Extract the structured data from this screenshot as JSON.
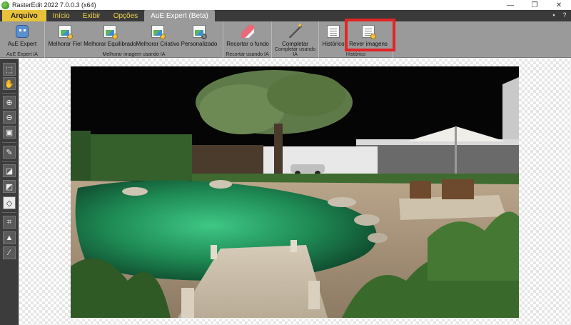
{
  "window": {
    "title": "RasterEdit 2022 7.0.0.3 (x64)",
    "minimize_glyph": "—",
    "restore_glyph": "❐",
    "close_glyph": "✕"
  },
  "menu": {
    "tabs": [
      {
        "label": "Arquivo"
      },
      {
        "label": "Início"
      },
      {
        "label": "Exibir"
      },
      {
        "label": "Opções"
      },
      {
        "label": "AuE Expert (Beta)"
      }
    ],
    "active_tab": "AuE Expert (Beta)",
    "save_glyph": "💾",
    "help_glyph": "?"
  },
  "ribbon": {
    "groups": [
      {
        "label": "AuE Expert IA",
        "buttons": [
          {
            "label": "AuE Expert",
            "icon": "robot-icon"
          }
        ]
      },
      {
        "label": "Melhorar imagem usando IA",
        "buttons": [
          {
            "label": "Melhorar Fiel",
            "icon": "image-sparkle-icon"
          },
          {
            "label": "Melhorar Equilibrado",
            "icon": "image-sparkle-icon"
          },
          {
            "label": "Melhorar Criativo",
            "icon": "image-sparkle-icon"
          },
          {
            "label": "Personalizado",
            "icon": "image-gear-icon"
          }
        ]
      },
      {
        "label": "Recortar usando IA",
        "buttons": [
          {
            "label": "Recortar o fundo",
            "icon": "eraser-icon"
          }
        ]
      },
      {
        "label": "Completar usando IA",
        "buttons": [
          {
            "label": "Completar",
            "icon": "magic-wand-icon"
          }
        ]
      },
      {
        "label": "Histórico",
        "buttons": [
          {
            "label": "Histórico",
            "icon": "history-doc-icon"
          },
          {
            "label": "Rever imagens",
            "icon": "review-doc-icon"
          }
        ]
      }
    ]
  },
  "tools": [
    "select-icon",
    "hand-icon",
    "zoom-in-icon",
    "zoom-out-icon",
    "fit-screen-icon",
    "eyedropper-icon",
    "eraser-icon",
    "brush-eraser-icon",
    "mask-icon",
    "crop-icon",
    "stamp-icon",
    "color-picker-icon"
  ],
  "colors": {
    "highlight": "#e22525",
    "file_tab": "#e8c23a",
    "menu_text": "#f3d34a",
    "ribbon_bg": "#9a9a9a"
  }
}
